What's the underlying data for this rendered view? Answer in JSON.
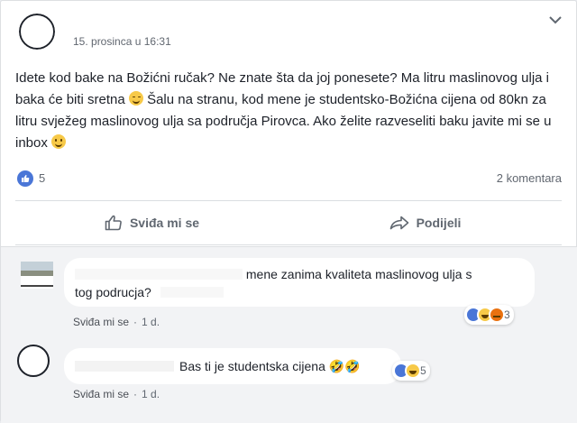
{
  "post": {
    "timestamp": "15. prosinca u 16:31",
    "text_part1": "Idete kod bake na Božićni ručak? Ne znate šta da joj ponesete? Ma litru maslinovog ulja i baka će biti sretna ",
    "text_part2": " Šalu na stranu, kod mene je studentsko-Božićna cijena od 80kn za litru svježeg maslinovog ulja sa područja Pirovca. Ako želite razveseliti baku javite mi se u inbox ",
    "emoji_1": "wink-emoji",
    "emoji_2": "smile-emoji"
  },
  "reactions": {
    "like_count": "5",
    "comments_label": "2 komentara"
  },
  "actions": {
    "like_label": "Sviđa mi se",
    "share_label": "Podijeli"
  },
  "comments": [
    {
      "text_tail": "mene zanima kvaliteta maslinovog ulja s",
      "text_line2": "tog podrucja? ",
      "like_label": "Sviđa mi se",
      "age": "1 d.",
      "reaction_count": "3",
      "reaction_icons": [
        "like",
        "haha",
        "angry"
      ]
    },
    {
      "text": "Bas ti je studentska cijena 🤣🤣",
      "like_label": "Sviđa mi se",
      "age": "1 d.",
      "reaction_count": "5",
      "reaction_icons": [
        "like",
        "haha"
      ]
    }
  ],
  "colors": {
    "like_blue": "#4a76d7",
    "text": "#1d2129",
    "muted": "#616770",
    "comment_bg": "#f2f3f5"
  }
}
